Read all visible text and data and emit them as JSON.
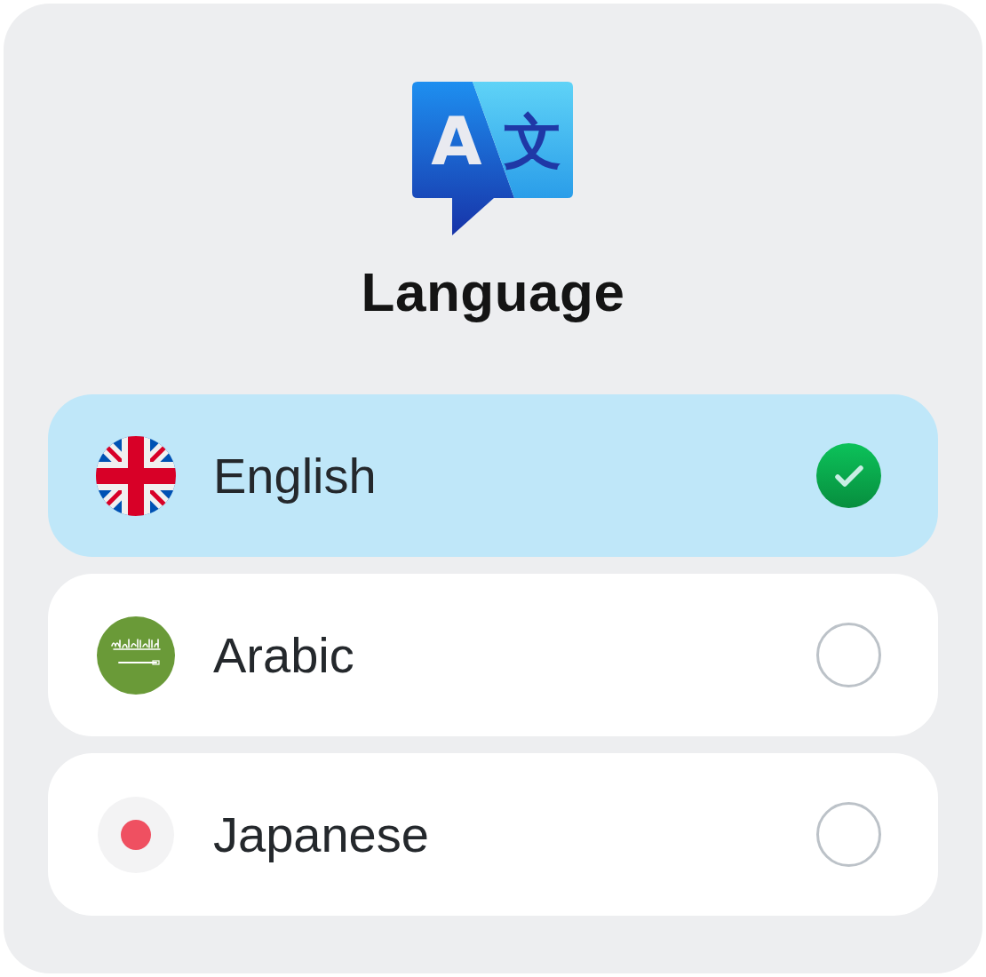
{
  "header": {
    "icon_glyphs": [
      "A",
      "文"
    ],
    "title": "Language"
  },
  "options": [
    {
      "label": "English",
      "kind": "united-kingdom",
      "selected": true
    },
    {
      "label": "Arabic",
      "kind": "saudi-arabia",
      "selected": false
    },
    {
      "label": "Japanese",
      "kind": "japan",
      "selected": false
    }
  ]
}
